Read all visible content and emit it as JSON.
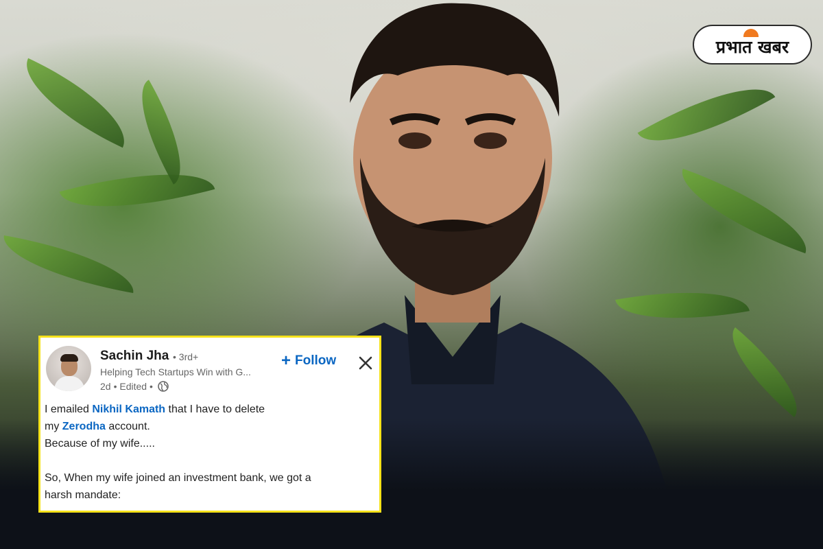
{
  "brand": {
    "logo_text": "प्रभात खबर"
  },
  "post": {
    "author_name": "Sachin Jha",
    "degree": "• 3rd+",
    "headline": "Helping Tech Startups Win with G...",
    "time": "2d",
    "edited": "• Edited •",
    "follow_label": "Follow",
    "body": {
      "line1_pre": "I emailed ",
      "line1_mention": "Nikhil Kamath",
      "line1_post": " that I have to delete",
      "line2_pre": "my ",
      "line2_mention": "Zerodha",
      "line2_post": " account.",
      "line3": "Because of my wife.....",
      "line4": "So, When my wife joined an investment bank, we got a",
      "line5": "harsh mandate:"
    }
  },
  "colors": {
    "link_blue": "#0a66c2",
    "highlight_border": "#f5e21a",
    "brand_orange": "#f07a20"
  },
  "icons": [
    "plus-icon",
    "close-icon",
    "globe-icon"
  ]
}
